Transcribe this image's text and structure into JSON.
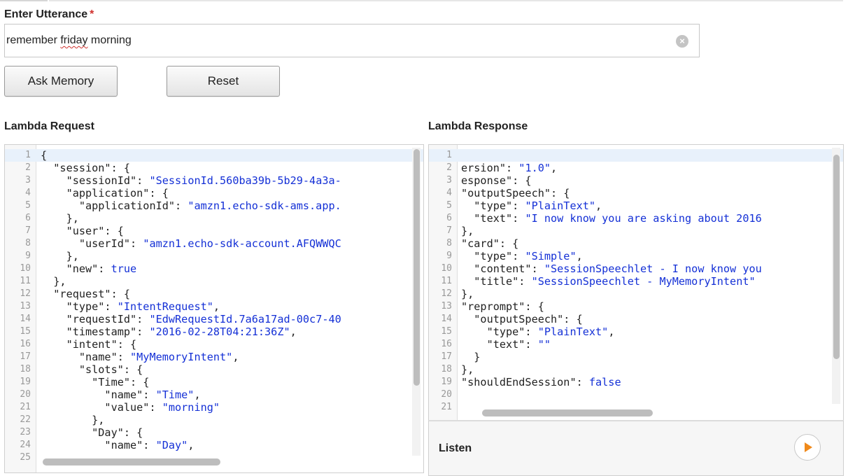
{
  "utterance": {
    "label": "Enter Utterance",
    "required_mark": "*",
    "value_before": "remember ",
    "value_misspelled": "friday",
    "value_after": " morning"
  },
  "buttons": {
    "ask": "Ask Memory",
    "reset": "Reset"
  },
  "request": {
    "title": "Lambda Request",
    "lines": [
      {
        "n": "1",
        "t": "{"
      },
      {
        "n": "2",
        "t": "  \"session\": {"
      },
      {
        "n": "3",
        "t": "    \"sessionId\": \"SessionId.560ba39b-5b29-4a3a-"
      },
      {
        "n": "4",
        "t": "    \"application\": {"
      },
      {
        "n": "5",
        "t": "      \"applicationId\": \"amzn1.echo-sdk-ams.app."
      },
      {
        "n": "6",
        "t": "    },"
      },
      {
        "n": "7",
        "t": "    \"user\": {"
      },
      {
        "n": "8",
        "t": "      \"userId\": \"amzn1.echo-sdk-account.AFQWWQC"
      },
      {
        "n": "9",
        "t": "    },"
      },
      {
        "n": "10",
        "t": "    \"new\": true"
      },
      {
        "n": "11",
        "t": "  },"
      },
      {
        "n": "12",
        "t": "  \"request\": {"
      },
      {
        "n": "13",
        "t": "    \"type\": \"IntentRequest\","
      },
      {
        "n": "14",
        "t": "    \"requestId\": \"EdwRequestId.7a6a17ad-00c7-40"
      },
      {
        "n": "15",
        "t": "    \"timestamp\": \"2016-02-28T04:21:36Z\","
      },
      {
        "n": "16",
        "t": "    \"intent\": {"
      },
      {
        "n": "17",
        "t": "      \"name\": \"MyMemoryIntent\","
      },
      {
        "n": "18",
        "t": "      \"slots\": {"
      },
      {
        "n": "19",
        "t": "        \"Time\": {"
      },
      {
        "n": "20",
        "t": "          \"name\": \"Time\","
      },
      {
        "n": "21",
        "t": "          \"value\": \"morning\""
      },
      {
        "n": "22",
        "t": "        },"
      },
      {
        "n": "23",
        "t": "        \"Day\": {"
      },
      {
        "n": "24",
        "t": "          \"name\": \"Day\","
      },
      {
        "n": "25",
        "t": ""
      }
    ]
  },
  "response": {
    "title": "Lambda Response",
    "lines": [
      {
        "n": "1",
        "t": ""
      },
      {
        "n": "2",
        "t": "ersion\": \"1.0\","
      },
      {
        "n": "3",
        "t": "esponse\": {"
      },
      {
        "n": "4",
        "t": "\"outputSpeech\": {"
      },
      {
        "n": "5",
        "t": "  \"type\": \"PlainText\","
      },
      {
        "n": "6",
        "t": "  \"text\": \"I now know you are asking about 2016"
      },
      {
        "n": "7",
        "t": "},"
      },
      {
        "n": "8",
        "t": "\"card\": {"
      },
      {
        "n": "9",
        "t": "  \"type\": \"Simple\","
      },
      {
        "n": "10",
        "t": "  \"content\": \"SessionSpeechlet - I now know you"
      },
      {
        "n": "11",
        "t": "  \"title\": \"SessionSpeechlet - MyMemoryIntent\""
      },
      {
        "n": "12",
        "t": "},"
      },
      {
        "n": "13",
        "t": "\"reprompt\": {"
      },
      {
        "n": "14",
        "t": "  \"outputSpeech\": {"
      },
      {
        "n": "15",
        "t": "    \"type\": \"PlainText\","
      },
      {
        "n": "16",
        "t": "    \"text\": \"\""
      },
      {
        "n": "17",
        "t": "  }"
      },
      {
        "n": "18",
        "t": "},"
      },
      {
        "n": "19",
        "t": "\"shouldEndSession\": false"
      },
      {
        "n": "20",
        "t": ""
      },
      {
        "n": "21",
        "t": ""
      }
    ]
  },
  "listen": {
    "label": "Listen",
    "icon": "play-icon"
  },
  "colors": {
    "string": "#1430d6",
    "keyword": "#1430d6",
    "gutter": "#f7f7f7",
    "active_line": "#e8f1fb",
    "play_accent": "#f0891a"
  }
}
